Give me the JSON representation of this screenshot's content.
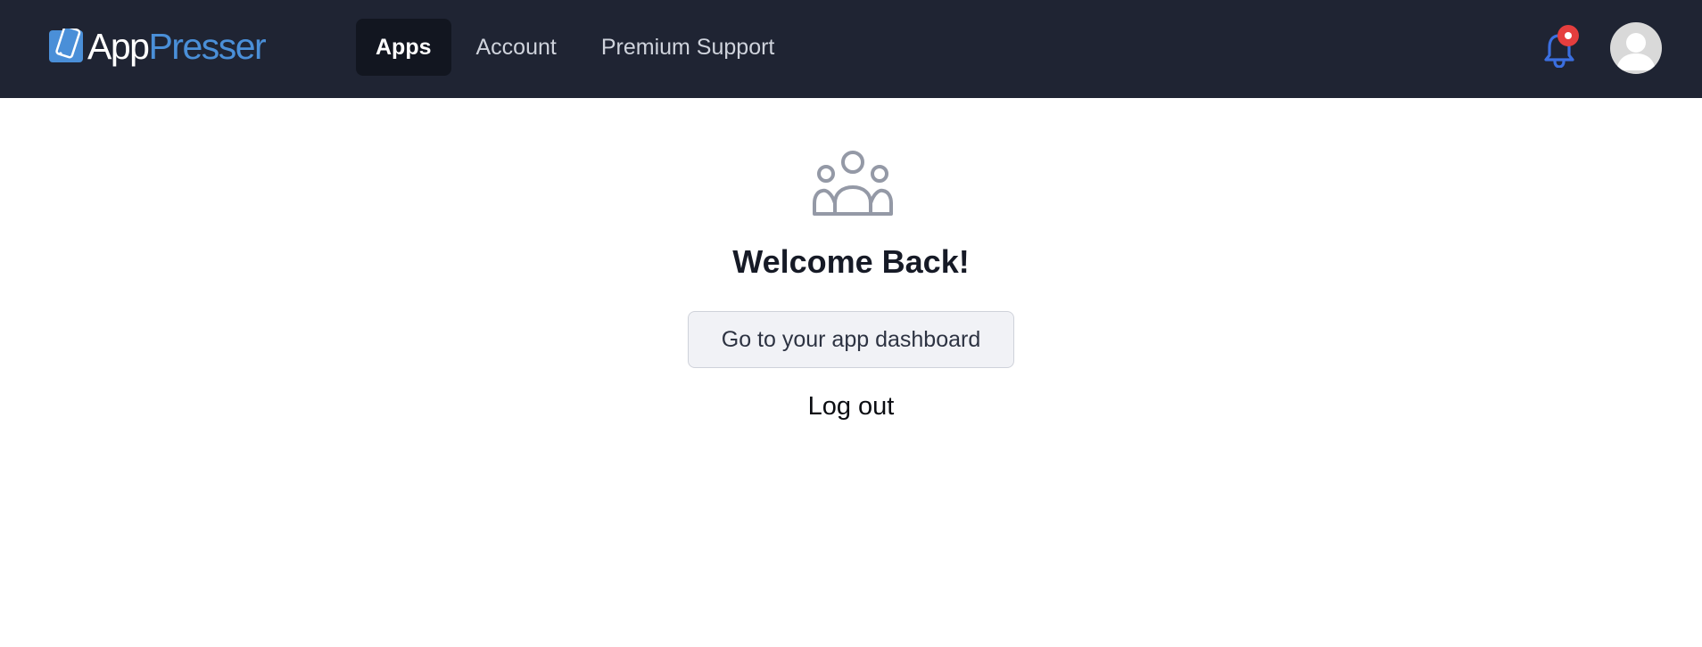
{
  "brand": {
    "logo_app": "App",
    "logo_presser": "Presser",
    "icon": "phone-logo-icon",
    "colors": {
      "navbar": "#1f2433",
      "accent": "#4a8fd8",
      "notification": "#e53e3e"
    }
  },
  "nav": {
    "tabs": [
      {
        "label": "Apps",
        "active": true
      },
      {
        "label": "Account",
        "active": false
      },
      {
        "label": "Premium Support",
        "active": false
      }
    ]
  },
  "header_icons": {
    "notifications": "bell-icon",
    "profile": "user-avatar-icon"
  },
  "main": {
    "icon": "user-group-icon",
    "title": "Welcome Back!",
    "dashboard_button": "Go to your app dashboard",
    "logout_link": "Log out"
  }
}
